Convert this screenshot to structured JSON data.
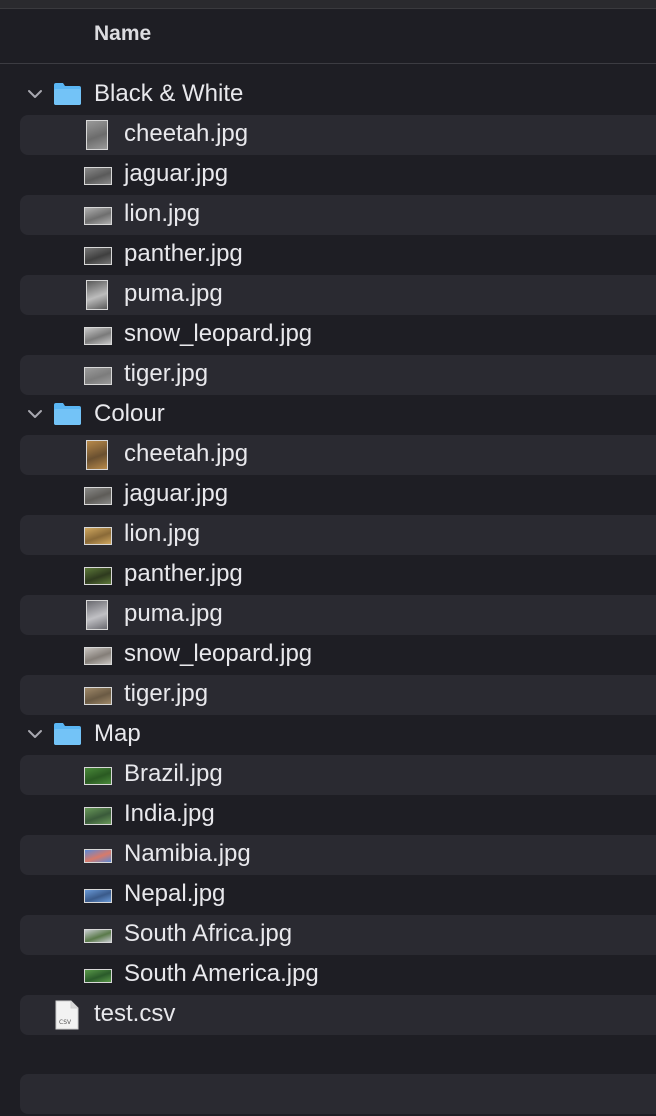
{
  "header": {
    "name_column": "Name"
  },
  "colors": {
    "folder_blue": "#5ab6f4",
    "stripe": "#2a2a31",
    "background": "#1e1e24"
  },
  "tree": [
    {
      "type": "folder",
      "name": "Black & White",
      "icon": "folder-icon",
      "expanded": true,
      "children": [
        {
          "name": "cheetah.jpg",
          "thumb": "portrait",
          "colors": [
            "#9a9a9a",
            "#6c6c6c"
          ]
        },
        {
          "name": "jaguar.jpg",
          "thumb": "landscape",
          "colors": [
            "#8a8a8a",
            "#5a5a5a"
          ]
        },
        {
          "name": "lion.jpg",
          "thumb": "landscape",
          "colors": [
            "#b0b0b0",
            "#6e6e6e"
          ]
        },
        {
          "name": "panther.jpg",
          "thumb": "landscape",
          "colors": [
            "#777777",
            "#3f3f3f"
          ]
        },
        {
          "name": "puma.jpg",
          "thumb": "portrait",
          "colors": [
            "#5a5a5a",
            "#bcbcbc"
          ]
        },
        {
          "name": "snow_leopard.jpg",
          "thumb": "landscape",
          "colors": [
            "#c8c8c8",
            "#7a7a7a"
          ]
        },
        {
          "name": "tiger.jpg",
          "thumb": "landscape",
          "colors": [
            "#9c9c9c",
            "#7c7c7c"
          ]
        }
      ]
    },
    {
      "type": "folder",
      "name": "Colour",
      "icon": "folder-icon",
      "expanded": true,
      "children": [
        {
          "name": "cheetah.jpg",
          "thumb": "portrait",
          "colors": [
            "#b88a4a",
            "#6a5030"
          ]
        },
        {
          "name": "jaguar.jpg",
          "thumb": "landscape",
          "colors": [
            "#8a8a88",
            "#5e5c58"
          ]
        },
        {
          "name": "lion.jpg",
          "thumb": "landscape",
          "colors": [
            "#d0a860",
            "#8a6a38"
          ]
        },
        {
          "name": "panther.jpg",
          "thumb": "landscape",
          "colors": [
            "#5e7a3a",
            "#2e3a1e"
          ]
        },
        {
          "name": "puma.jpg",
          "thumb": "portrait",
          "colors": [
            "#6a6a70",
            "#c0c0c4"
          ]
        },
        {
          "name": "snow_leopard.jpg",
          "thumb": "landscape",
          "colors": [
            "#c8c4c0",
            "#847e78"
          ]
        },
        {
          "name": "tiger.jpg",
          "thumb": "landscape",
          "colors": [
            "#a08a6a",
            "#6a5a44"
          ]
        }
      ]
    },
    {
      "type": "folder",
      "name": "Map",
      "icon": "folder-icon",
      "expanded": true,
      "children": [
        {
          "name": "Brazil.jpg",
          "thumb": "landscape",
          "colors": [
            "#4a8a3a",
            "#2a5a22"
          ]
        },
        {
          "name": "India.jpg",
          "thumb": "landscape",
          "colors": [
            "#6a9a5a",
            "#3a5a3a"
          ]
        },
        {
          "name": "Namibia.jpg",
          "thumb": "panorama",
          "colors": [
            "#5a8ad8",
            "#d87a6a"
          ]
        },
        {
          "name": "Nepal.jpg",
          "thumb": "panorama",
          "colors": [
            "#6a9ad8",
            "#3a5a8a"
          ]
        },
        {
          "name": "South Africa.jpg",
          "thumb": "panorama",
          "colors": [
            "#c8ccd0",
            "#5a7a4a"
          ]
        },
        {
          "name": "South America.jpg",
          "thumb": "panorama",
          "colors": [
            "#5a9a4a",
            "#2a5a2a"
          ]
        }
      ]
    },
    {
      "type": "file",
      "name": "test.csv",
      "icon": "csv-file-icon",
      "badge": "CSV"
    }
  ]
}
